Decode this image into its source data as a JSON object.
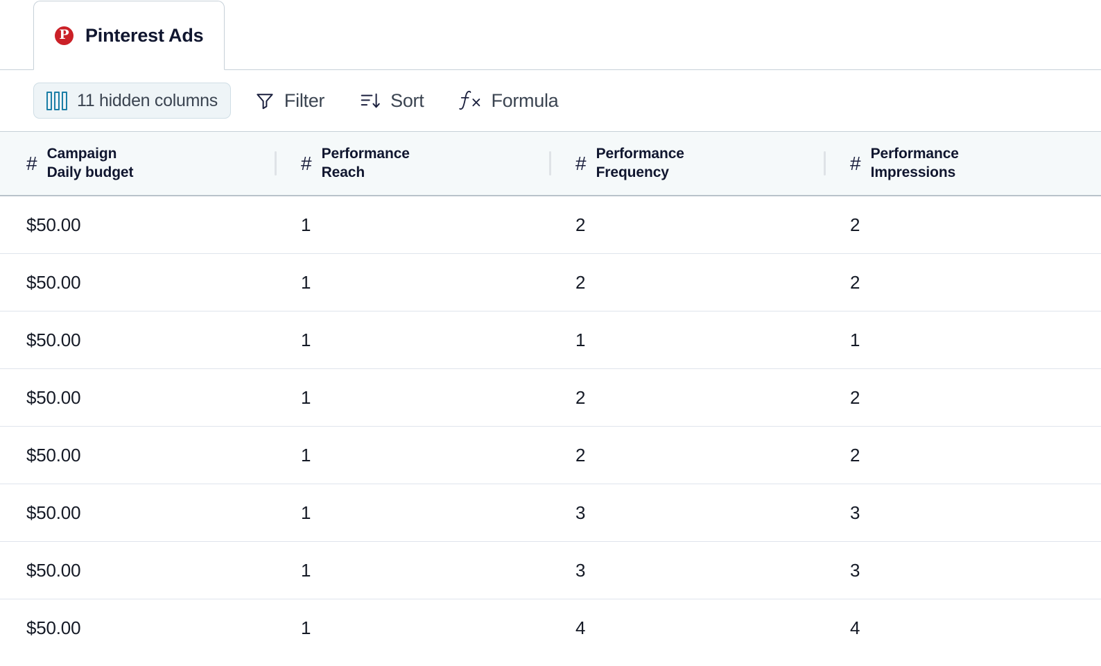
{
  "tab": {
    "label": "Pinterest Ads",
    "icon": "pinterest-icon",
    "active": true
  },
  "toolbar": {
    "hidden_columns": {
      "label": "11 hidden columns",
      "count": 11,
      "icon": "columns-icon",
      "accent_color": "#1b7ea6",
      "background_color": "#eef4f7"
    },
    "filter": {
      "label": "Filter",
      "icon": "filter-funnel-icon"
    },
    "sort": {
      "label": "Sort",
      "icon": "sort-descending-icon"
    },
    "formula": {
      "label": "Formula",
      "icon": "formula-fx-icon"
    }
  },
  "table": {
    "columns": [
      {
        "group": "Campaign",
        "name": "Daily budget",
        "type_icon": "#",
        "type": "number"
      },
      {
        "group": "Performance",
        "name": "Reach",
        "type_icon": "#",
        "type": "number"
      },
      {
        "group": "Performance",
        "name": "Frequency",
        "type_icon": "#",
        "type": "number"
      },
      {
        "group": "Performance",
        "name": "Impressions",
        "type_icon": "#",
        "type": "number"
      }
    ],
    "rows": [
      [
        "$50.00",
        "1",
        "2",
        "2"
      ],
      [
        "$50.00",
        "1",
        "2",
        "2"
      ],
      [
        "$50.00",
        "1",
        "1",
        "1"
      ],
      [
        "$50.00",
        "1",
        "2",
        "2"
      ],
      [
        "$50.00",
        "1",
        "2",
        "2"
      ],
      [
        "$50.00",
        "1",
        "3",
        "3"
      ],
      [
        "$50.00",
        "1",
        "3",
        "3"
      ],
      [
        "$50.00",
        "1",
        "4",
        "4"
      ]
    ]
  }
}
